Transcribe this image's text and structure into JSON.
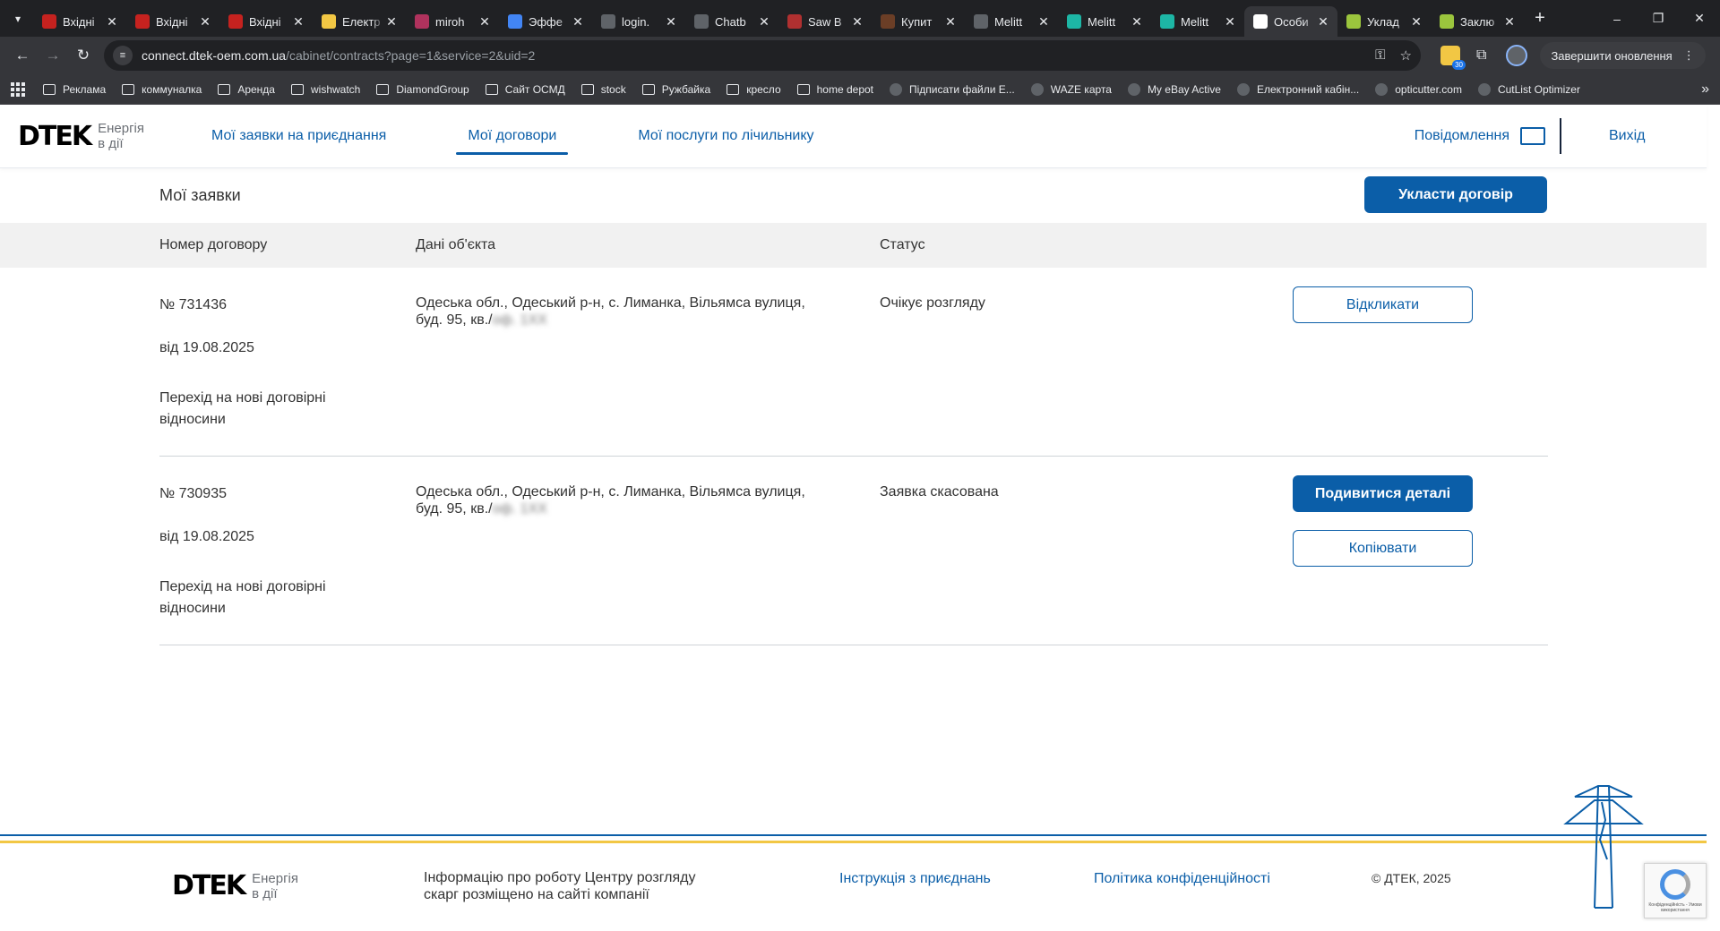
{
  "browser": {
    "tabs": [
      {
        "title": "Вхідні",
        "favicon": "gmail-icon",
        "color": "#c5221f",
        "active": false
      },
      {
        "title": "Вхідні",
        "favicon": "gmail-icon",
        "color": "#c5221f",
        "active": false
      },
      {
        "title": "Вхідні",
        "favicon": "gmail-icon",
        "color": "#c5221f",
        "active": false
      },
      {
        "title": "Електр",
        "favicon": "ukraine-flag-icon",
        "color": "#f2c744",
        "active": false
      },
      {
        "title": "miroh",
        "favicon": "w-icon",
        "color": "#b0325d",
        "active": false
      },
      {
        "title": "Эффе",
        "favicon": "chart-icon",
        "color": "#4285f4",
        "active": false
      },
      {
        "title": "login.",
        "favicon": "globe-icon",
        "color": "#5f6368",
        "active": false
      },
      {
        "title": "Chatb",
        "favicon": "openai-icon",
        "color": "#5f6368",
        "active": false
      },
      {
        "title": "Saw B",
        "favicon": "saw-icon",
        "color": "#b03030",
        "active": false
      },
      {
        "title": "Купит",
        "favicon": "coffee-icon",
        "color": "#6b3e26",
        "active": false
      },
      {
        "title": "Melitt",
        "favicon": "globe-icon",
        "color": "#5f6368",
        "active": false
      },
      {
        "title": "Melitt",
        "favicon": "op-icon",
        "color": "#1db6a5",
        "active": false
      },
      {
        "title": "Melitt",
        "favicon": "op-icon",
        "color": "#1db6a5",
        "active": false
      },
      {
        "title": "Особи",
        "favicon": "dtek-icon",
        "color": "#ffffff",
        "active": true
      },
      {
        "title": "Уклад",
        "favicon": "leaf-icon",
        "color": "#9bc53d",
        "active": false
      },
      {
        "title": "Заклю",
        "favicon": "leaf-icon",
        "color": "#9bc53d",
        "active": false
      }
    ],
    "url_host": "connect.dtek-oem.com.ua",
    "url_path": "/cabinet/contracts?page=1&service=2&uid=2",
    "extension_badge": "30",
    "update_label": "Завершити оновлення",
    "bookmarks": [
      {
        "label": "Реклама",
        "icon": "folder-icon"
      },
      {
        "label": "коммуналка",
        "icon": "folder-icon"
      },
      {
        "label": "Аренда",
        "icon": "folder-icon"
      },
      {
        "label": "wishwatch",
        "icon": "folder-icon"
      },
      {
        "label": "DiamondGroup",
        "icon": "folder-icon"
      },
      {
        "label": "Сайт ОСМД",
        "icon": "folder-icon"
      },
      {
        "label": "stock",
        "icon": "folder-icon"
      },
      {
        "label": "Ружбайка",
        "icon": "folder-icon"
      },
      {
        "label": "кресло",
        "icon": "folder-icon"
      },
      {
        "label": "home depot",
        "icon": "folder-icon"
      },
      {
        "label": "Підписати файли Е...",
        "icon": "site-icon"
      },
      {
        "label": "WAZE карта",
        "icon": "waze-icon"
      },
      {
        "label": "My eBay Active",
        "icon": "ebay-icon"
      },
      {
        "label": "Електронний кабін...",
        "icon": "site-icon"
      },
      {
        "label": "opticutter.com",
        "icon": "globe-icon"
      },
      {
        "label": "CutList Optimizer",
        "icon": "site-icon"
      }
    ]
  },
  "header": {
    "logo_mark": "DTEK",
    "logo_tag_line1": "Енергія",
    "logo_tag_line2": "в дії",
    "nav": [
      {
        "label": "Мої заявки на приєднання",
        "active": false
      },
      {
        "label": "Мої договори",
        "active": true
      },
      {
        "label": "Мої послуги по лічильнику",
        "active": false
      }
    ],
    "notifications_label": "Повідомлення",
    "logout_label": "Вихід"
  },
  "main": {
    "title": "Мої заявки",
    "create_button": "Укласти договір",
    "columns": [
      "Номер договору",
      "Дані об'єкта",
      "Статус"
    ],
    "rows": [
      {
        "number": "№ 731436",
        "date": "від 19.08.2025",
        "type_line1": "Перехід на нові договірні",
        "type_line2": "відносини",
        "address_line1": "Одеська обл., Одеський р-н, с. Лиманка, Вільямса вулиця,",
        "address_line2": "буд. 95, кв./",
        "address_hidden": "оф. 1ХХ",
        "status": "Очікує розгляду",
        "actions": [
          {
            "label": "Відкликати",
            "style": "outline"
          }
        ]
      },
      {
        "number": "№ 730935",
        "date": "від 19.08.2025",
        "type_line1": "Перехід на нові договірні",
        "type_line2": "відносини",
        "address_line1": "Одеська обл., Одеський р-н, с. Лиманка, Вільямса вулиця,",
        "address_line2": "буд. 95, кв./",
        "address_hidden": "оф. 1ХХ",
        "status": "Заявка скасована",
        "actions": [
          {
            "label": "Подивитися деталі",
            "style": "filled"
          },
          {
            "label": "Копіювати",
            "style": "outline"
          }
        ]
      }
    ]
  },
  "footer": {
    "info_text": "Інформацію про роботу Центру розгляду скарг розміщено на сайті компанії",
    "link_instruction": "Інструкція з приєднань",
    "link_privacy": "Політика конфіденційності",
    "copyright": "© ДТЕК, 2025",
    "recaptcha_text": "Конфіденційність - Умови використання"
  },
  "colors": {
    "brand_blue": "#0b5ea8",
    "accent_yellow": "#f2c744",
    "chrome_dark": "#202124"
  }
}
